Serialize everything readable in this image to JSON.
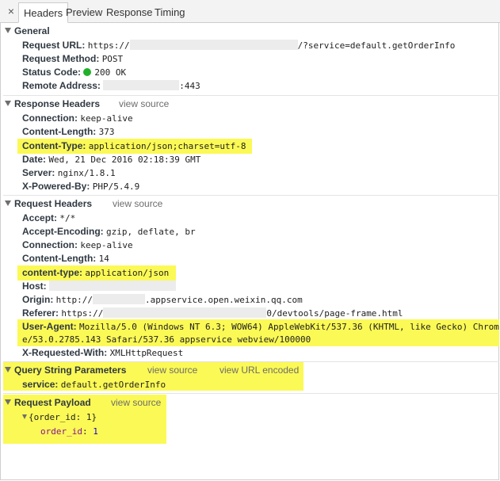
{
  "tabs": [
    "Headers",
    "Preview",
    "Response",
    "Timing"
  ],
  "active_tab": "Headers",
  "close_glyph": "×",
  "general": {
    "title": "General",
    "request_url_label": "Request URL:",
    "request_url_prefix": "https://",
    "request_url_suffix": "/?service=default.getOrderInfo",
    "request_method_label": "Request Method:",
    "request_method": "POST",
    "status_code_label": "Status Code:",
    "status_code": "200 OK",
    "status_color": "#22b02b",
    "remote_address_label": "Remote Address:",
    "remote_address_suffix": ":443"
  },
  "response_headers": {
    "title": "Response Headers",
    "view_source": "view source",
    "items": [
      {
        "k": "Connection:",
        "v": "keep-alive"
      },
      {
        "k": "Content-Length:",
        "v": "373"
      },
      {
        "k": "Content-Type:",
        "v": "application/json;charset=utf-8"
      },
      {
        "k": "Date:",
        "v": "Wed, 21 Dec 2016 02:18:39 GMT"
      },
      {
        "k": "Server:",
        "v": "nginx/1.8.1"
      },
      {
        "k": "X-Powered-By:",
        "v": "PHP/5.4.9"
      }
    ]
  },
  "request_headers": {
    "title": "Request Headers",
    "view_source": "view source",
    "accept": {
      "k": "Accept:",
      "v": "*/*"
    },
    "accept_encoding": {
      "k": "Accept-Encoding:",
      "v": "gzip, deflate, br"
    },
    "connection": {
      "k": "Connection:",
      "v": "keep-alive"
    },
    "content_length": {
      "k": "Content-Length:",
      "v": "14"
    },
    "content_type": {
      "k": "content-type:",
      "v": "application/json"
    },
    "host": {
      "k": "Host:"
    },
    "origin": {
      "k": "Origin:",
      "prefix": "http://",
      "suffix": ".appservice.open.weixin.qq.com"
    },
    "referer": {
      "k": "Referer:",
      "prefix": "https://",
      "suffix": "0/devtools/page-frame.html"
    },
    "user_agent": {
      "k": "User-Agent:",
      "line1": "Mozilla/5.0 (Windows NT 6.3; WOW64) AppleWebKit/537.36 (KHTML, like Gecko) Chrom",
      "line2": "e/53.0.2785.143 Safari/537.36 appservice webview/100000"
    },
    "x_requested_with": {
      "k": "X-Requested-With:",
      "v": "XMLHttpRequest"
    }
  },
  "query_params": {
    "title": "Query String Parameters",
    "view_source": "view source",
    "view_url_encoded": "view URL encoded",
    "items": [
      {
        "k": "service:",
        "v": "default.getOrderInfo"
      }
    ]
  },
  "payload": {
    "title": "Request Payload",
    "view_source": "view source",
    "summary": "{order_id: 1}",
    "key": "order_id",
    "value": "1"
  },
  "highlight_color": "#fbf955"
}
